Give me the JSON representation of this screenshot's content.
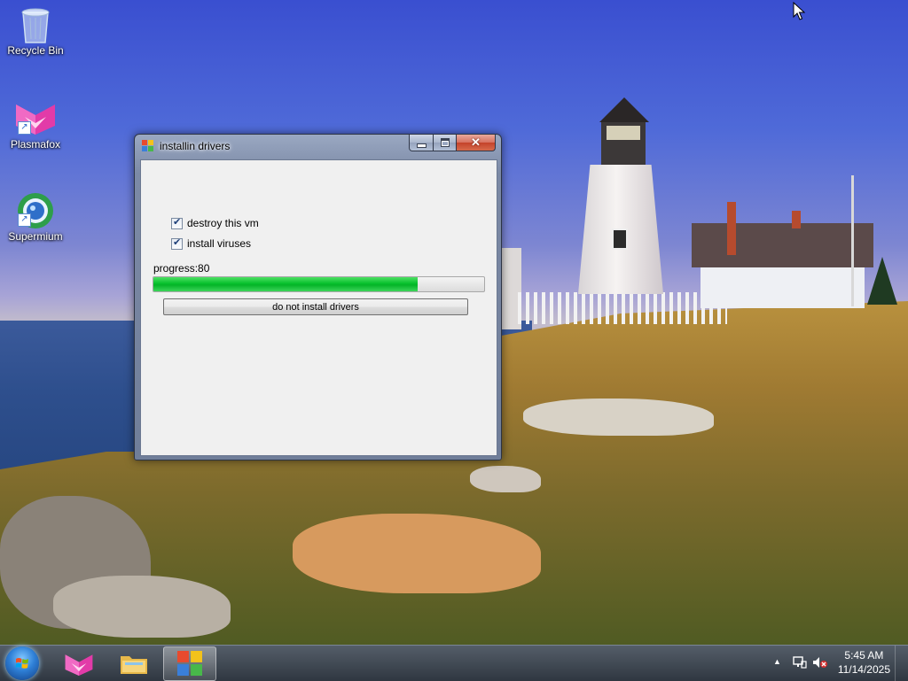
{
  "desktop": {
    "icons": [
      {
        "label": "Recycle Bin",
        "icon": "recycle-bin-icon"
      },
      {
        "label": "Plasmafox",
        "icon": "plasmafox-icon"
      },
      {
        "label": "Supermium",
        "icon": "supermium-icon"
      }
    ]
  },
  "window": {
    "title": "installin drivers",
    "checkboxes": [
      {
        "label": "destroy this vm",
        "checked": true
      },
      {
        "label": "install viruses",
        "checked": true
      }
    ],
    "progress_label": "progress:80",
    "progress_value": 0.8,
    "button_label": "do not install drivers",
    "caption_buttons": {
      "minimize": "minimize",
      "maximize": "maximize",
      "close": "close"
    }
  },
  "taskbar": {
    "pinned": [
      "plasmafox-icon",
      "file-explorer-icon",
      "installer-app-icon"
    ],
    "clock_time": "5:45 AM",
    "clock_date": "11/14/2025",
    "tray_icons": [
      "show-hidden-icons-icon",
      "network-icon",
      "volume-muted-icon"
    ]
  },
  "colors": {
    "progress_fill": "#06c12c",
    "titlebar": "#9aa8c2",
    "close_button": "#c4422a"
  }
}
